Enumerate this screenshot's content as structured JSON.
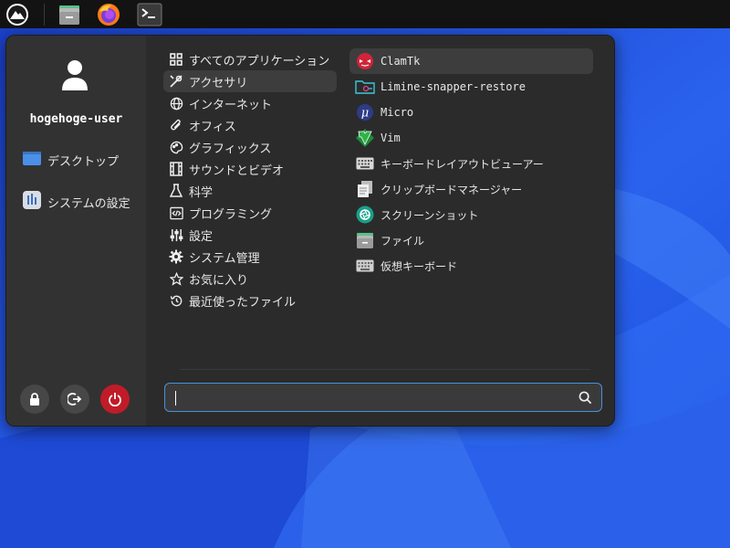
{
  "taskbar": {
    "icons": [
      "app-menu-icon",
      "file-manager-icon",
      "firefox-icon",
      "terminal-icon"
    ]
  },
  "user": {
    "name": "hogehoge-user"
  },
  "places": [
    {
      "label": "デスクトップ",
      "icon": "desktop-folder-icon"
    },
    {
      "label": "システムの設定",
      "icon": "system-settings-icon"
    }
  ],
  "session_buttons": [
    {
      "name": "lock",
      "icon": "lock-icon"
    },
    {
      "name": "logout",
      "icon": "logout-icon"
    },
    {
      "name": "power",
      "icon": "power-icon"
    }
  ],
  "categories": [
    {
      "label": "すべてのアプリケーション",
      "icon": "grid-icon"
    },
    {
      "label": "アクセサリ",
      "icon": "tools-icon",
      "selected": true
    },
    {
      "label": "インターネット",
      "icon": "globe-icon"
    },
    {
      "label": "オフィス",
      "icon": "paperclip-icon"
    },
    {
      "label": "グラフィックス",
      "icon": "palette-icon"
    },
    {
      "label": "サウンドとビデオ",
      "icon": "film-icon"
    },
    {
      "label": "科学",
      "icon": "flask-icon"
    },
    {
      "label": "プログラミング",
      "icon": "code-icon"
    },
    {
      "label": "設定",
      "icon": "sliders-icon"
    },
    {
      "label": "システム管理",
      "icon": "gear-icon"
    },
    {
      "label": "お気に入り",
      "icon": "star-icon"
    },
    {
      "label": "最近使ったファイル",
      "icon": "history-icon"
    }
  ],
  "apps": [
    {
      "label": "ClamTk",
      "icon": "clamtk-icon",
      "mono": true,
      "hovered": true
    },
    {
      "label": "Limine-snapper-restore",
      "icon": "limine-icon",
      "mono": true
    },
    {
      "label": "Micro",
      "icon": "micro-icon",
      "mono": true
    },
    {
      "label": "Vim",
      "icon": "vim-icon",
      "mono": true
    },
    {
      "label": "キーボードレイアウトビューアー",
      "icon": "keyboard-icon"
    },
    {
      "label": "クリップボードマネージャー",
      "icon": "clipboard-icon"
    },
    {
      "label": "スクリーンショット",
      "icon": "screenshot-icon"
    },
    {
      "label": "ファイル",
      "icon": "file-manager-icon"
    },
    {
      "label": "仮想キーボード",
      "icon": "virtual-keyboard-icon"
    }
  ],
  "search": {
    "value": "",
    "placeholder": ""
  },
  "colors": {
    "accent": "#4a8fe0",
    "power": "#c01c28",
    "menu_bg": "#2b2b2b",
    "sidebar_bg": "#323232"
  }
}
